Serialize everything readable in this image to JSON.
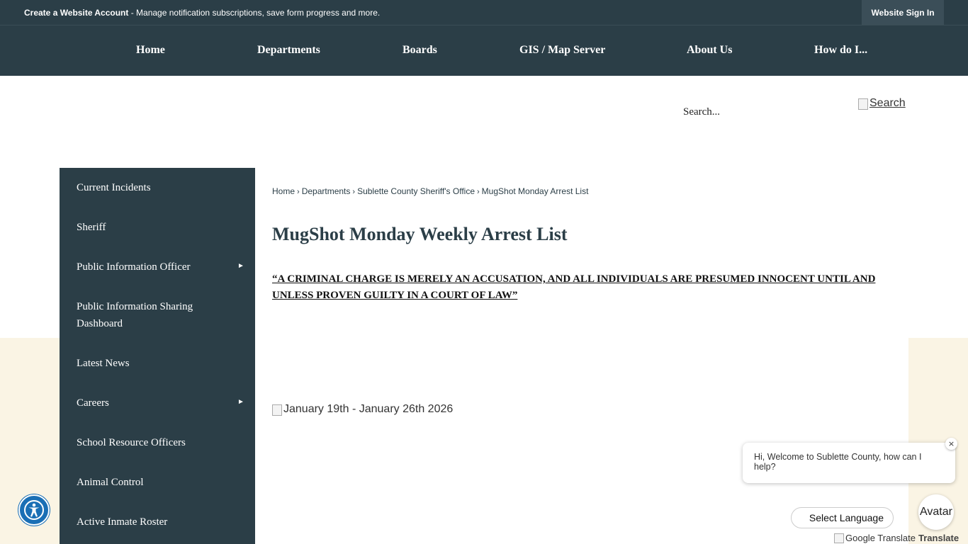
{
  "topbar": {
    "promo_strong": "Create a Website Account",
    "promo_rest": " - Manage notification subscriptions, save form progress and more.",
    "signin_label": "Website Sign In"
  },
  "nav": {
    "items": [
      "Home",
      "Departments",
      "Boards",
      "GIS / Map Server",
      "About Us",
      "How do I..."
    ]
  },
  "search": {
    "placeholder": "Search...",
    "button_alt": "Search"
  },
  "sidebar": {
    "items": [
      "Current Incidents",
      "Sheriff",
      "Public Information Officer",
      "Public Information Sharing Dashboard",
      "Latest News",
      "Careers",
      "School Resource Officers",
      "Animal Control",
      "Active Inmate Roster"
    ],
    "arrow_glyph": "►"
  },
  "breadcrumb": {
    "items": [
      "Home",
      "Departments",
      "Sublette County Sheriff's Office",
      "MugShot Monday Arrest List"
    ],
    "separator": "›"
  },
  "page": {
    "title": "MugShot Monday Weekly Arrest List",
    "disclaimer": "“A CRIMINAL CHARGE IS MERELY AN ACCUSATION, AND ALL INDIVIDUALS ARE PRESUMED INNOCENT UNTIL AND UNLESS PROVEN GUILTY IN A COURT OF LAW”",
    "arrest_image_alt": "January 19th - January 26th 2026"
  },
  "chat": {
    "message": "Hi, Welcome to Sublette County, how can I help?",
    "close_glyph": "×",
    "avatar_label": "Avatar"
  },
  "translate": {
    "select_label": "Select Language",
    "logo_alt": "Google Translate",
    "label": "Translate"
  },
  "colors": {
    "nav_bg": "#2b3e47",
    "cream_bg": "#faf4e4",
    "accessibility_blue": "#1a6fb5"
  },
  "icons": [
    "accessibility-icon",
    "submenu-arrow-icon",
    "close-icon",
    "broken-image-icon"
  ]
}
